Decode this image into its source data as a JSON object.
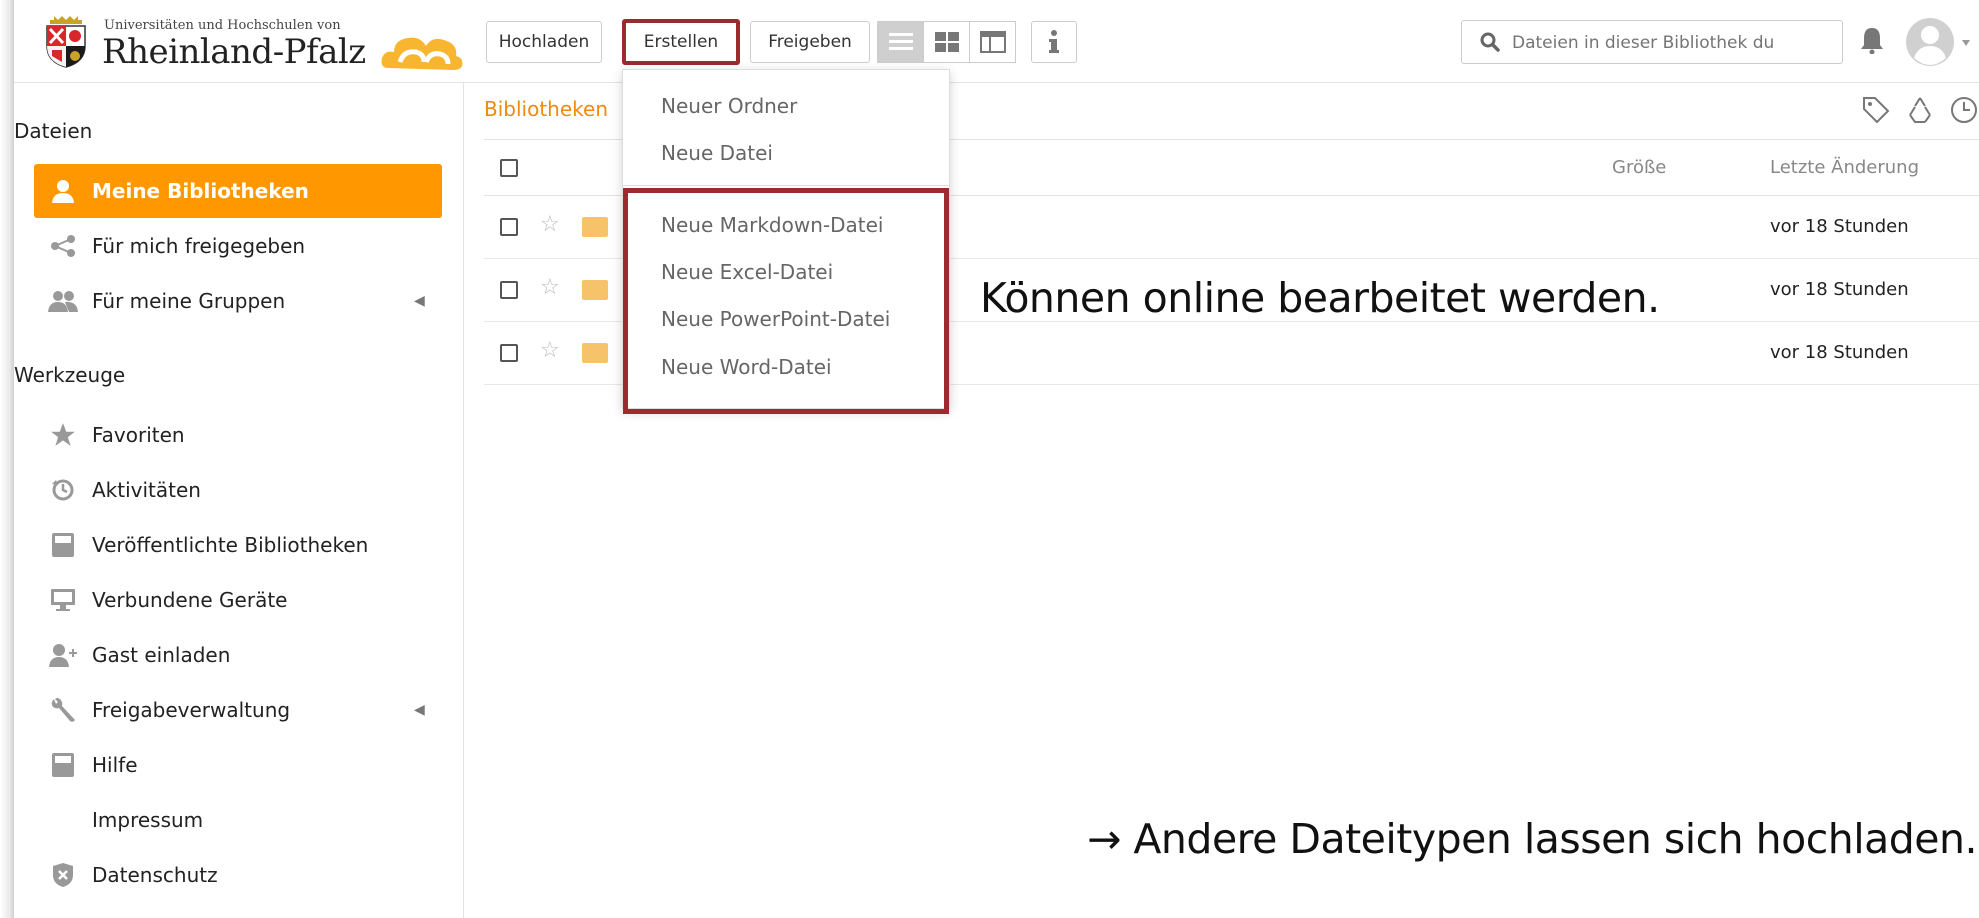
{
  "brand": {
    "line1": "Universitäten und Hochschulen von",
    "line2": "Rheinland-Pfalz"
  },
  "toolbar": {
    "upload_label": "Hochladen",
    "create_label": "Erstellen",
    "share_label": "Freigeben",
    "view_icons": [
      "list-view-icon",
      "grid-view-icon",
      "detail-view-icon"
    ],
    "info_icon": "info-icon"
  },
  "search": {
    "placeholder": "Dateien in dieser Bibliothek du"
  },
  "sidebar": {
    "files_title": "Dateien",
    "files_items": [
      {
        "label": "Meine Bibliotheken",
        "icon": "user-icon",
        "active": true
      },
      {
        "label": "Für mich freigegeben",
        "icon": "share-icon"
      },
      {
        "label": "Für meine Gruppen",
        "icon": "group-icon"
      }
    ],
    "tools_title": "Werkzeuge",
    "tools_items": [
      {
        "label": "Favoriten",
        "icon": "star-icon"
      },
      {
        "label": "Aktivitäten",
        "icon": "history-icon"
      },
      {
        "label": "Veröffentlichte Bibliotheken",
        "icon": "book-icon"
      },
      {
        "label": "Verbundene Geräte",
        "icon": "monitor-icon"
      },
      {
        "label": "Gast einladen",
        "icon": "user-plus-icon"
      },
      {
        "label": "Freigabeverwaltung",
        "icon": "wrench-icon"
      },
      {
        "label": "Hilfe",
        "icon": "book-icon"
      },
      {
        "label": "Impressum",
        "icon": ""
      },
      {
        "label": "Datenschutz",
        "icon": "shield-icon"
      }
    ]
  },
  "main": {
    "breadcrumb": "Bibliotheken",
    "columns": {
      "size": "Größe",
      "modified": "Letzte Änderung"
    },
    "rows": [
      {
        "modified": "vor 18 Stunden"
      },
      {
        "modified": "vor 18 Stunden"
      },
      {
        "modified": "vor 18 Stunden"
      }
    ]
  },
  "dropdown": {
    "items": [
      "Neuer Ordner",
      "Neue Datei",
      "Neue Markdown-Datei",
      "Neue Excel-Datei",
      "Neue PowerPoint-Datei",
      "Neue Word-Datei"
    ]
  },
  "annotations": {
    "online_edit": "Können online bearbeitet werden.",
    "other_types": "→ Andere Dateitypen lassen sich hochladen."
  },
  "colors": {
    "accent": "#ff9800",
    "highlight_box": "#9c2a2f",
    "breadcrumb": "#ef8a0c"
  }
}
